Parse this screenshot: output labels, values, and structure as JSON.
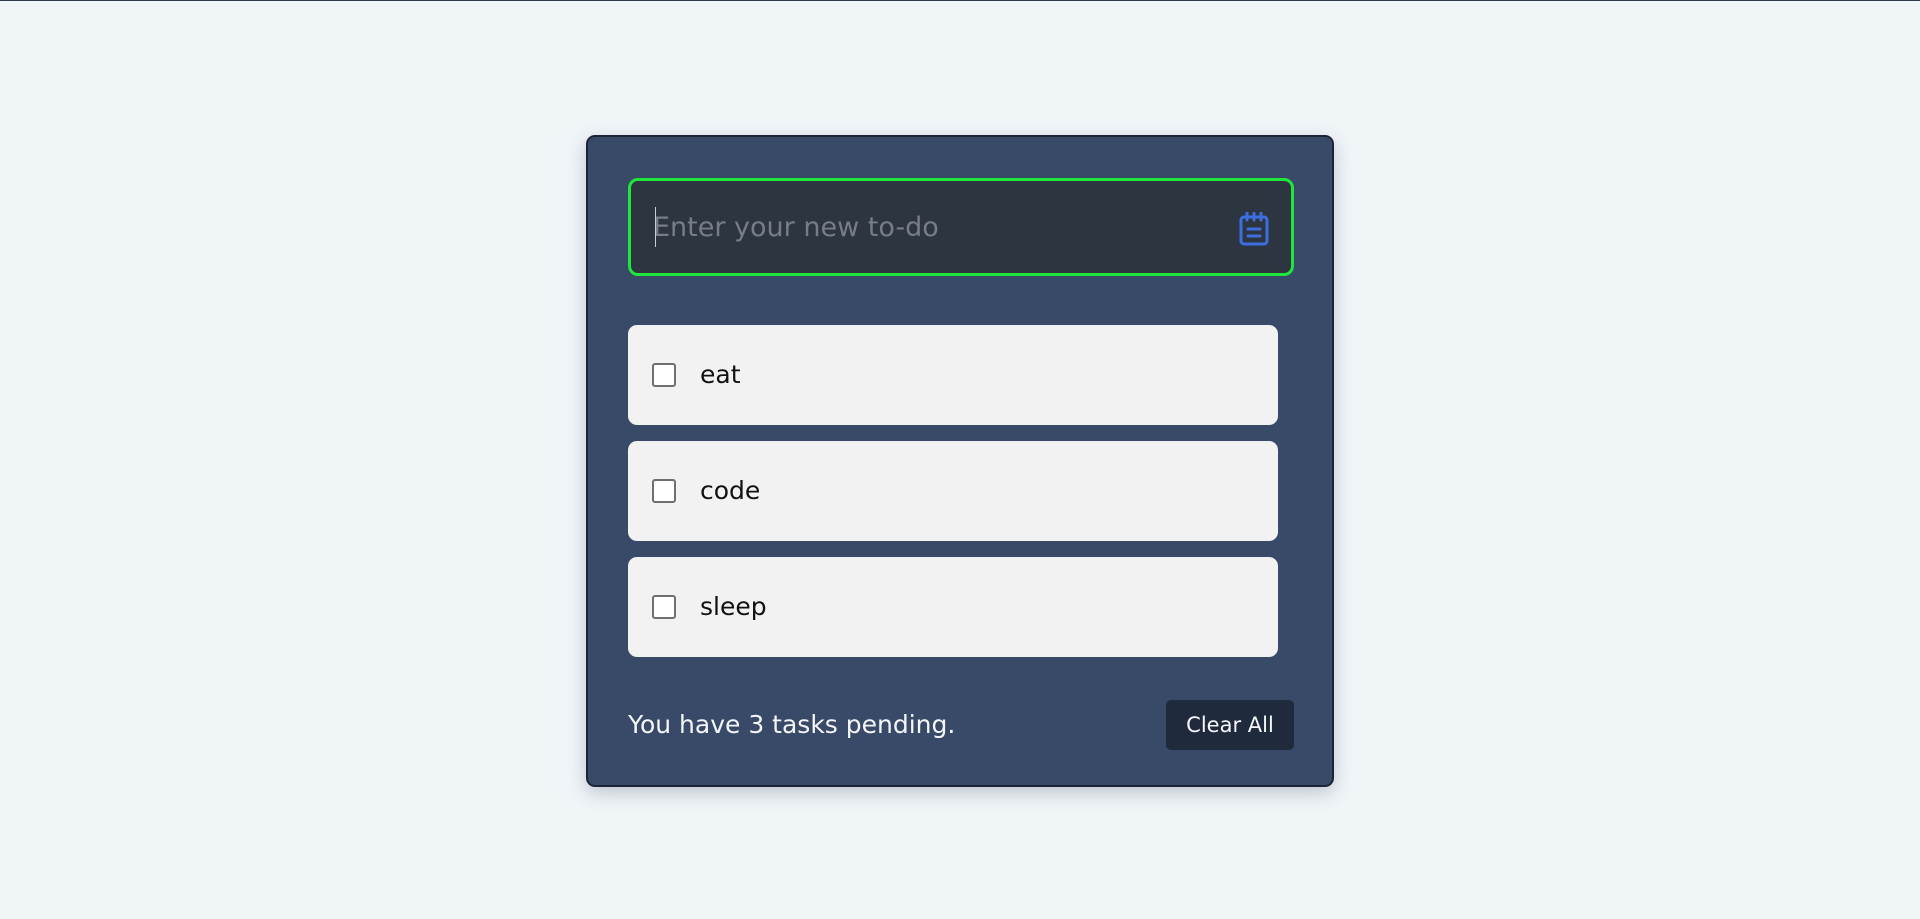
{
  "todo_input": {
    "placeholder": "Enter your new to-do",
    "value": ""
  },
  "add_icon": "notepad-icon",
  "tasks": [
    {
      "label": "eat",
      "checked": false
    },
    {
      "label": "code",
      "checked": false
    },
    {
      "label": "sleep",
      "checked": false
    }
  ],
  "footer": {
    "pending_text": "You have 3 tasks pending.",
    "clear_label": "Clear All"
  },
  "colors": {
    "page_background": "#f0f5f8",
    "card_background": "#394a68",
    "input_background": "#2d3640",
    "input_focus_border": "#1ee63a",
    "icon_accent": "#3d6ee0",
    "task_background": "#f2f2f2",
    "button_background": "#1f2a3d"
  }
}
